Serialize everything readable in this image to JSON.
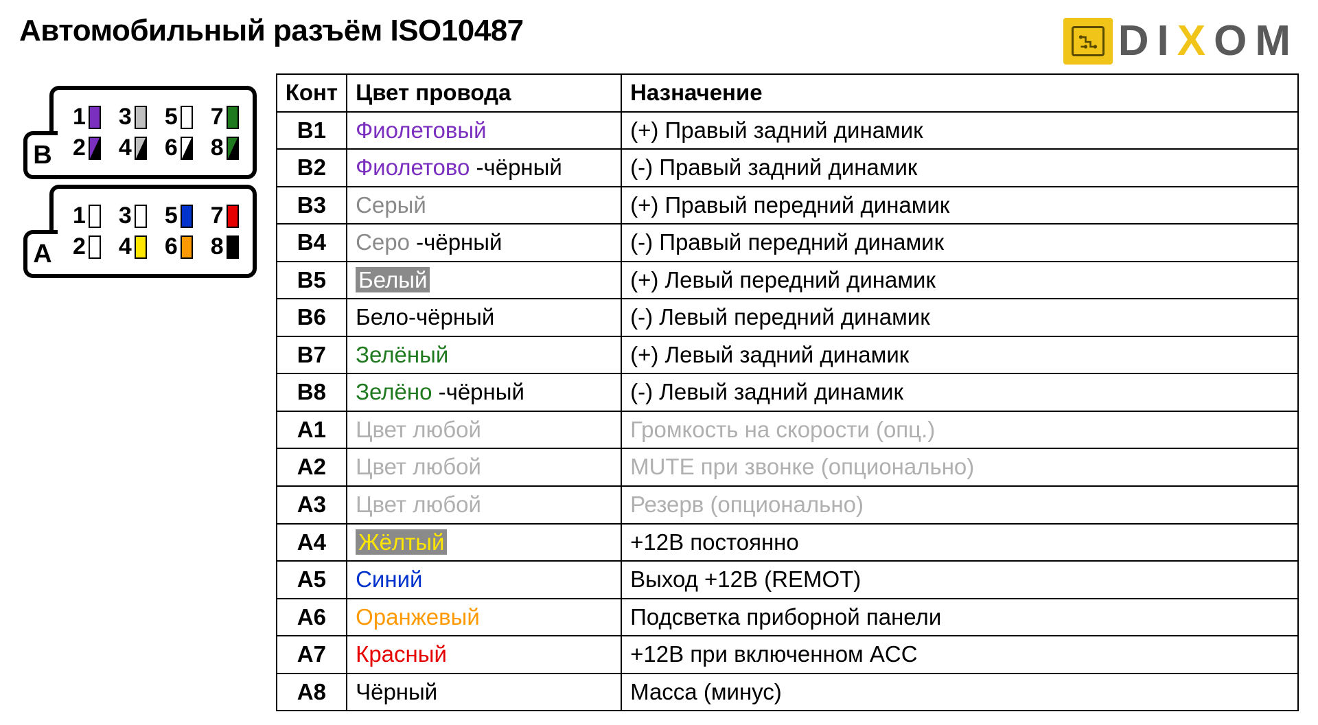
{
  "title": "Автомобильный разъём ISO10487",
  "logo": {
    "brand_d": "D",
    "brand_i": "I",
    "brand_x": "X",
    "brand_o": "O",
    "brand_m": "M"
  },
  "connector": {
    "blockB": {
      "label": "B"
    },
    "blockA": {
      "label": "A"
    }
  },
  "pins_diagram": {
    "B": [
      {
        "n": "1",
        "fill": "#7b2fbf"
      },
      {
        "n": "3",
        "fill": "#c0c0c0"
      },
      {
        "n": "5",
        "fill": "#ffffff"
      },
      {
        "n": "7",
        "fill": "#1f7a1f"
      },
      {
        "n": "2",
        "diag": true,
        "c1": "#7b2fbf",
        "c2": "#000000"
      },
      {
        "n": "4",
        "diag": true,
        "c1": "#c0c0c0",
        "c2": "#000000"
      },
      {
        "n": "6",
        "diag": true,
        "c1": "#ffffff",
        "c2": "#000000"
      },
      {
        "n": "8",
        "diag": true,
        "c1": "#1f7a1f",
        "c2": "#000000"
      }
    ],
    "A": [
      {
        "n": "1",
        "fill": "#ffffff"
      },
      {
        "n": "3",
        "fill": "#ffffff"
      },
      {
        "n": "5",
        "fill": "#0033cc"
      },
      {
        "n": "7",
        "fill": "#e60000"
      },
      {
        "n": "2",
        "fill": "#ffffff"
      },
      {
        "n": "4",
        "fill": "#ffe600"
      },
      {
        "n": "6",
        "fill": "#ff9900"
      },
      {
        "n": "8",
        "fill": "#000000"
      }
    ]
  },
  "table": {
    "headers": {
      "pin": "Конт",
      "color": "Цвет провода",
      "func": "Назначение"
    },
    "rows": [
      {
        "pin": "B1",
        "color_parts": [
          {
            "t": "Фиолетовый",
            "c": "#7b2fbf"
          }
        ],
        "func": "(+) Правый задний динамик"
      },
      {
        "pin": "B2",
        "color_parts": [
          {
            "t": "Фиолетово",
            "c": "#7b2fbf"
          },
          {
            "t": " -чёрный",
            "c": "#000000"
          }
        ],
        "func": "(-)  Правый задний динамик"
      },
      {
        "pin": "B3",
        "color_parts": [
          {
            "t": "Серый",
            "c": "#8a8a8a"
          }
        ],
        "func": "(+) Правый передний динамик"
      },
      {
        "pin": "B4",
        "color_parts": [
          {
            "t": "Серо",
            "c": "#8a8a8a"
          },
          {
            "t": " -чёрный",
            "c": "#000000"
          }
        ],
        "func": "(-)  Правый передний динамик"
      },
      {
        "pin": "B5",
        "color_parts": [
          {
            "t": "Белый",
            "c": "#ffffff",
            "bg": "#8a8a8a"
          }
        ],
        "func": "(+) Левый передний динамик"
      },
      {
        "pin": "B6",
        "color_parts": [
          {
            "t": "Бело-чёрный",
            "c": "#000000"
          }
        ],
        "func": "(-)  Левый передний динамик"
      },
      {
        "pin": "B7",
        "color_parts": [
          {
            "t": "Зелёный",
            "c": "#1f7a1f"
          }
        ],
        "func": "(+) Левый задний динамик"
      },
      {
        "pin": "B8",
        "color_parts": [
          {
            "t": "Зелёно",
            "c": "#1f7a1f"
          },
          {
            "t": " -чёрный",
            "c": "#000000"
          }
        ],
        "func": "(-)  Левый задний динамик"
      },
      {
        "pin": "A1",
        "color_parts": [
          {
            "t": "Цвет любой",
            "c": "#b0b0b0"
          }
        ],
        "func": "Громкость на скорости (опц.)",
        "func_c": "#b0b0b0"
      },
      {
        "pin": "A2",
        "color_parts": [
          {
            "t": "Цвет любой",
            "c": "#b0b0b0"
          }
        ],
        "func": "MUTE при звонке (опционально)",
        "func_c": "#b0b0b0"
      },
      {
        "pin": "A3",
        "color_parts": [
          {
            "t": "Цвет любой",
            "c": "#b0b0b0"
          }
        ],
        "func": "Резерв (опционально)",
        "func_c": "#b0b0b0"
      },
      {
        "pin": "A4",
        "color_parts": [
          {
            "t": "Жёлтый",
            "c": "#ffe600",
            "bg": "#8a8a8a"
          }
        ],
        "func": "+12В постоянно"
      },
      {
        "pin": "A5",
        "color_parts": [
          {
            "t": "Синий",
            "c": "#0033cc"
          }
        ],
        "func": "Выход +12В (REMOT)"
      },
      {
        "pin": "A6",
        "color_parts": [
          {
            "t": "Оранжевый",
            "c": "#ff9900"
          }
        ],
        "func": "Подсветка приборной панели"
      },
      {
        "pin": "A7",
        "color_parts": [
          {
            "t": "Красный",
            "c": "#e60000"
          }
        ],
        "func": "+12В при включенном ACC"
      },
      {
        "pin": "A8",
        "color_parts": [
          {
            "t": "Чёрный",
            "c": "#000000"
          }
        ],
        "func": "Масса (минус)"
      }
    ]
  }
}
